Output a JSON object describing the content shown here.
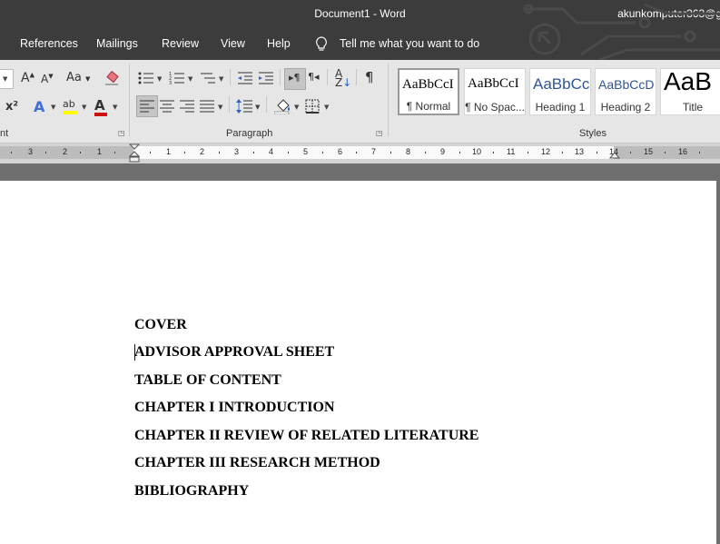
{
  "window": {
    "title": "Document1  -  Word",
    "user": "akunkomputer363@g"
  },
  "menu": {
    "items": [
      "References",
      "Mailings",
      "Review",
      "View",
      "Help"
    ],
    "tell_me": "Tell me what you want to do"
  },
  "ribbon": {
    "groups": {
      "font": "nt",
      "paragraph": "Paragraph",
      "styles": "Styles"
    },
    "styles": [
      {
        "preview": "AaBbCcI",
        "name": "¶ Normal"
      },
      {
        "preview": "AaBbCcI",
        "name": "¶ No Spac..."
      },
      {
        "preview": "AaBbCc",
        "name": "Heading 1"
      },
      {
        "preview": "AaBbCcD",
        "name": "Heading 2"
      },
      {
        "preview": "AaB",
        "name": "Title"
      }
    ],
    "font_buttons": {
      "grow": "A",
      "shrink": "A",
      "case": "Aa",
      "super": "x²",
      "color": "A"
    },
    "paragraph_buttons": {
      "sort": "A↓",
      "pilcrow": "¶"
    }
  },
  "ruler": {
    "numbers": [
      "3",
      "2",
      "1",
      "1",
      "2",
      "3",
      "4",
      "5",
      "6",
      "7",
      "8",
      "9",
      "10",
      "11",
      "12",
      "13",
      "14",
      "15",
      "16"
    ]
  },
  "document": {
    "lines": [
      "COVER",
      "ADVISOR APPROVAL SHEET",
      "TABLE OF CONTENT",
      "CHAPTER I INTRODUCTION",
      "CHAPTER II REVIEW OF RELATED LITERATURE",
      "CHAPTER III RESEARCH METHOD",
      "BIBLIOGRAPHY"
    ]
  }
}
